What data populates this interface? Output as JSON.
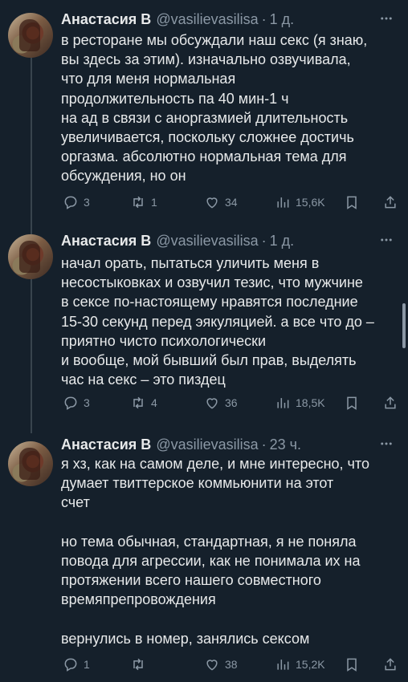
{
  "tweets": [
    {
      "name": "Анастасия В",
      "handle": "@vasilievasilisa",
      "dot": "·",
      "time": "1 д.",
      "text": "в ресторане мы обсуждали наш секс (я знаю,\nвы здесь за этим). изначально озвучивала,\nчто для меня нормальная\nпродолжительность па 40 мин-1 ч\nна ад в связи с аноргазмией длительность\nувеличивается, поскольку сложнее достичь\nоргазма. абсолютно нормальная тема для\nобсуждения, но он",
      "replies": "3",
      "retweets": "1",
      "likes": "34",
      "views": "15,6K"
    },
    {
      "name": "Анастасия В",
      "handle": "@vasilievasilisa",
      "dot": "·",
      "time": "1 д.",
      "text": "начал орать, пытаться уличить меня в\nнесостыковках и озвучил тезис, что мужчине\nв сексе по-настоящему нравятся последние\n15-30 секунд перед эякуляцией. а все что до –\nприятно чисто психологически\nи вообще, мой бывший был прав, выделять\nчас на секс – это пиздец",
      "replies": "3",
      "retweets": "4",
      "likes": "36",
      "views": "18,5K"
    },
    {
      "name": "Анастасия В",
      "handle": "@vasilievasilisa",
      "dot": "·",
      "time": "23 ч.",
      "text": "я хз, как на самом деле, и мне интересно, что\nдумает твиттерское коммьюнити на этот\nсчет\n\nно тема обычная, стандартная, я не поняла\nповода для агрессии, как не понимала их на\nпротяжении всего нашего совместного\nвремяпрепровождения\n\nвернулись в номер, занялись сексом",
      "replies": "1",
      "retweets": "",
      "likes": "38",
      "views": "15,2K"
    }
  ],
  "icons": {
    "more": "more-horizontal-icon",
    "reply": "reply-icon",
    "retweet": "retweet-icon",
    "like": "heart-icon",
    "views": "views-chart-icon",
    "bookmark": "bookmark-icon",
    "share": "share-icon"
  },
  "colors": {
    "background": "#15202b",
    "text": "#e7e9ea",
    "muted": "#8b98a5",
    "line": "#38444d"
  }
}
